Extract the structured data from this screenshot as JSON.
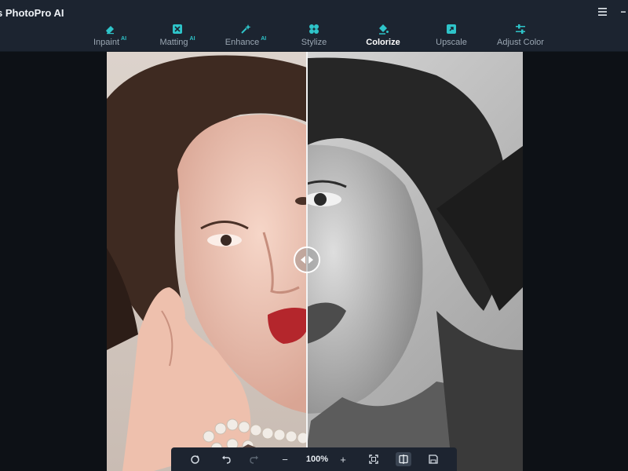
{
  "app": {
    "title": "s PhotoPro AI"
  },
  "window": {
    "menu_icon": "hamburger-menu-icon",
    "minimize_icon": "minimize-icon"
  },
  "tools": [
    {
      "label": "Inpaint",
      "badge": "AI",
      "icon": "eraser-icon",
      "active": false
    },
    {
      "label": "Matting",
      "badge": "AI",
      "icon": "matting-icon",
      "active": false
    },
    {
      "label": "Enhance",
      "badge": "AI",
      "icon": "enhance-sparkle-icon",
      "active": false
    },
    {
      "label": "Stylize",
      "badge": "",
      "icon": "stylize-icon",
      "active": false
    },
    {
      "label": "Colorize",
      "badge": "",
      "icon": "paint-bucket-icon",
      "active": true
    },
    {
      "label": "Upscale",
      "badge": "",
      "icon": "upscale-icon",
      "active": false
    },
    {
      "label": "Adjust Color",
      "badge": "",
      "icon": "sliders-icon",
      "active": false
    }
  ],
  "viewer": {
    "compare_handle": "compare-slider-handle"
  },
  "bottom_toolbar": {
    "reset_icon": "reset-icon",
    "undo_icon": "undo-icon",
    "redo_icon": "redo-icon",
    "zoom_out": "−",
    "zoom_level": "100%",
    "zoom_in": "+",
    "fit_icon": "fit-to-screen-icon",
    "compare_icon": "compare-view-icon",
    "save_icon": "save-icon"
  },
  "colors": {
    "accent": "#2ec4c9",
    "topbar_bg": "#1c2430",
    "canvas_bg": "#0d1116"
  }
}
